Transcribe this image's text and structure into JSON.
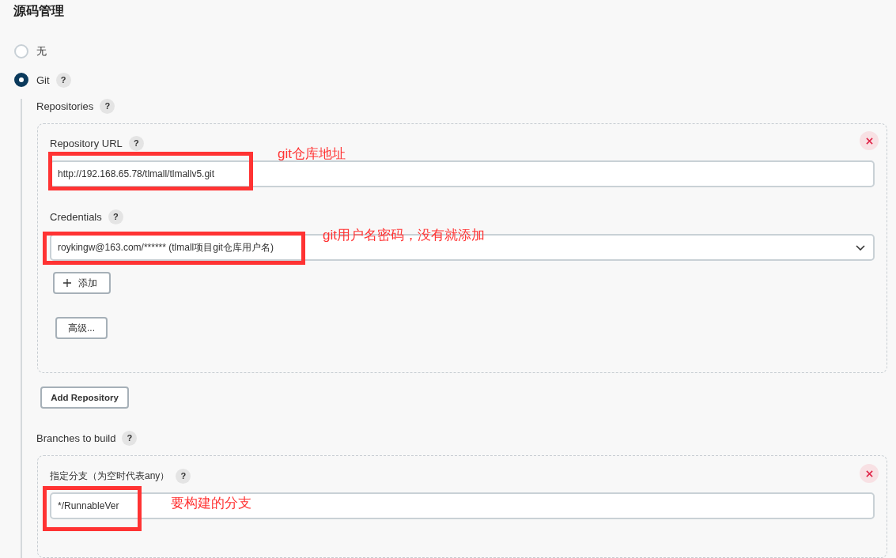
{
  "section_title": "源码管理",
  "scm_options": [
    {
      "label": "无",
      "selected": false
    },
    {
      "label": "Git",
      "selected": true,
      "help": "?"
    }
  ],
  "git": {
    "repositories": {
      "label": "Repositories",
      "help": "?",
      "items": [
        {
          "url": {
            "label": "Repository URL",
            "help": "?",
            "value": "http://192.168.65.78/tlmall/tlmallv5.git",
            "note": "git仓库地址"
          },
          "credentials": {
            "label": "Credentials",
            "help": "?",
            "value": "roykingw@163.com/****** (tlmall项目git仓库用户名)",
            "note": "git用户名密码，没有就添加"
          },
          "add_button": "添加",
          "advanced_button": "高级..."
        }
      ]
    },
    "add_repository_button": "Add Repository",
    "branches": {
      "label": "Branches to build",
      "help": "?",
      "items": [
        {
          "label": "指定分支（为空时代表any）",
          "help": "?",
          "value": "*/RunnableVer",
          "note": "要构建的分支"
        }
      ]
    }
  }
}
